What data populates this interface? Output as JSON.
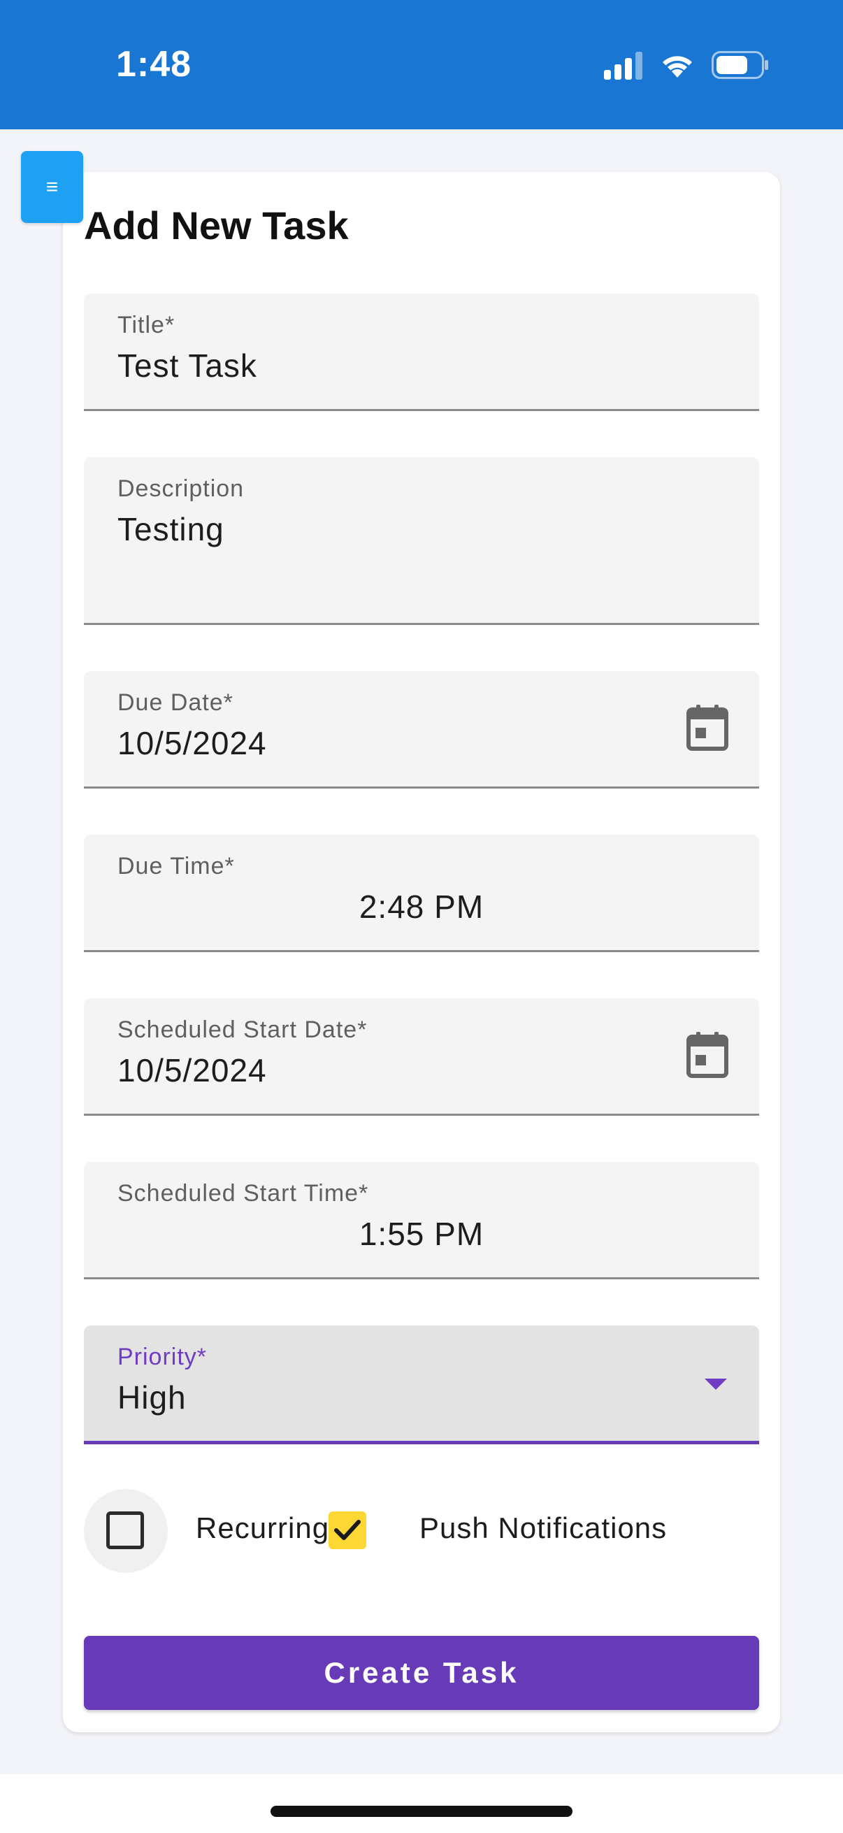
{
  "status_bar": {
    "time": "1:48",
    "icons": [
      "signal-icon",
      "wifi-icon",
      "battery-icon"
    ]
  },
  "menu_button": {
    "icon": "menu-icon",
    "label": "≡"
  },
  "form": {
    "title": "Add New Task",
    "fields": {
      "title": {
        "label": "Title*",
        "value": "Test Task"
      },
      "description": {
        "label": "Description",
        "value": "Testing"
      },
      "due_date": {
        "label": "Due Date*",
        "value": "10/5/2024",
        "icon": "calendar-icon"
      },
      "due_time": {
        "label": "Due Time*",
        "value": "2:48 PM"
      },
      "start_date": {
        "label": "Scheduled Start Date*",
        "value": "10/5/2024",
        "icon": "calendar-icon"
      },
      "start_time": {
        "label": "Scheduled Start Time*",
        "value": "1:55 PM"
      },
      "priority": {
        "label": "Priority*",
        "value": "High"
      }
    },
    "options": {
      "recurring": {
        "label": "Recurring",
        "checked": false
      },
      "push_notifications": {
        "label": "Push Notifications",
        "checked": true
      }
    },
    "submit_label": "Create Task"
  },
  "colors": {
    "status_bar": "#1976d2",
    "menu_button": "#1ea1f2",
    "accent": "#673ab7",
    "checkbox_checked": "#fdd835"
  }
}
